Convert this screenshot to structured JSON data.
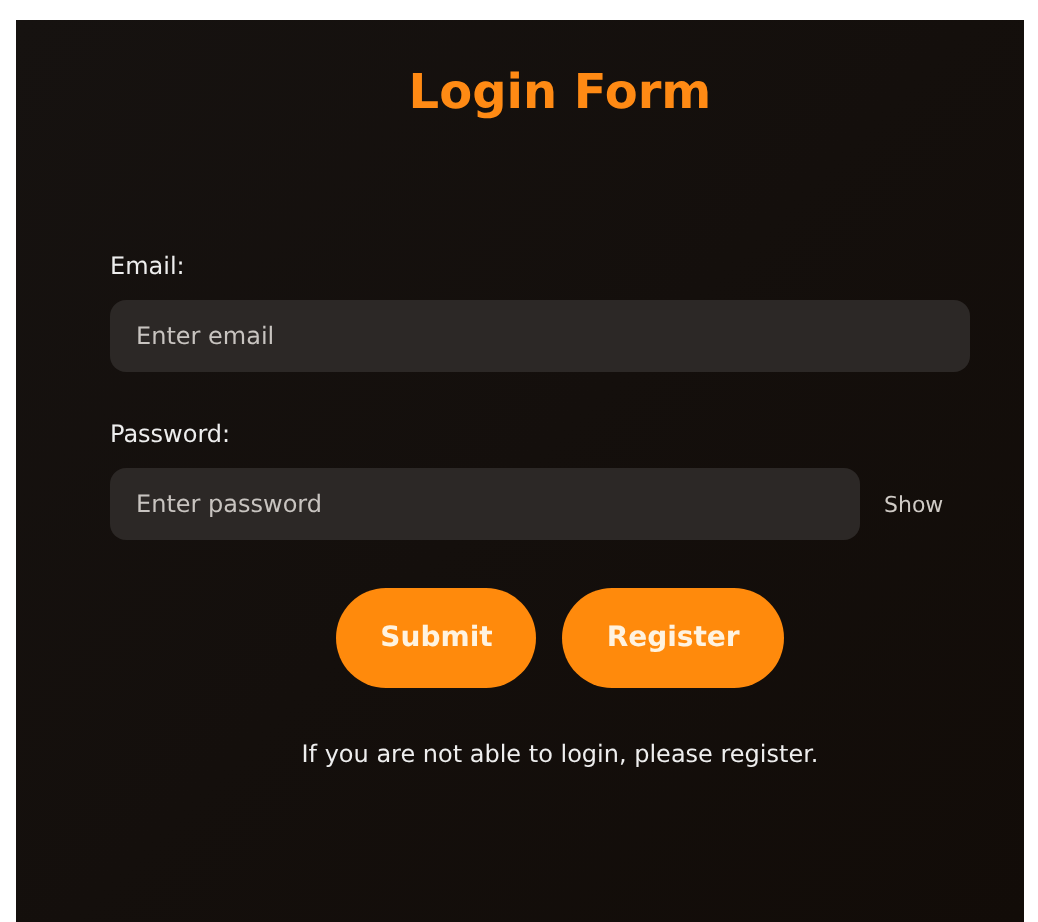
{
  "title": "Login Form",
  "fields": [
    {
      "label": "Email:",
      "placeholder": "Enter email"
    },
    {
      "label": "Password:",
      "placeholder": "Enter password",
      "toggle": "Show"
    }
  ],
  "buttons": [
    "Submit",
    "Register"
  ],
  "note": "If you are not able to login, please register."
}
